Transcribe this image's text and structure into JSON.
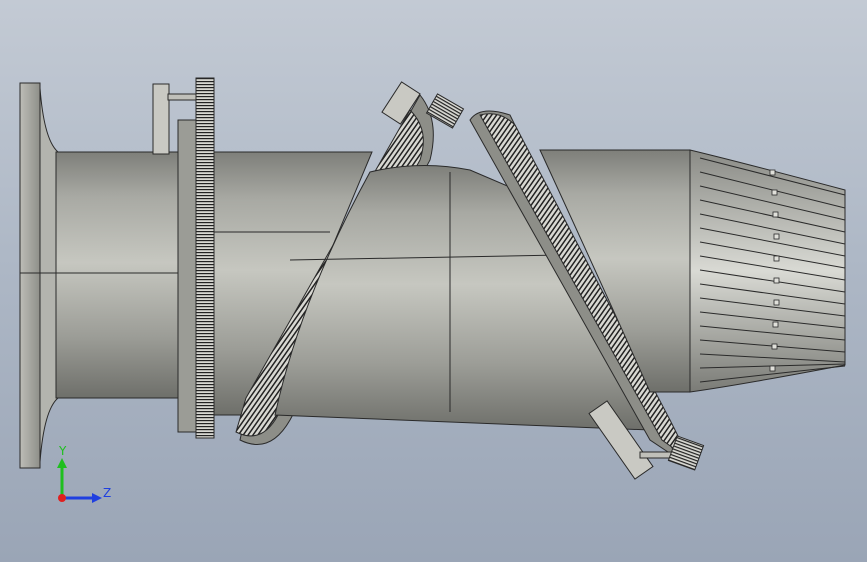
{
  "viewport": {
    "background_top": "#c3cad4",
    "background_bottom": "#9aa5b6",
    "model_color": "#a9aaa4",
    "edge_color": "#2a2a2a"
  },
  "triad": {
    "y_label": "Y",
    "z_label": "Z",
    "y_color": "#1fbf1f",
    "z_color": "#1f3fe0",
    "x_color": "#e01f1f"
  }
}
